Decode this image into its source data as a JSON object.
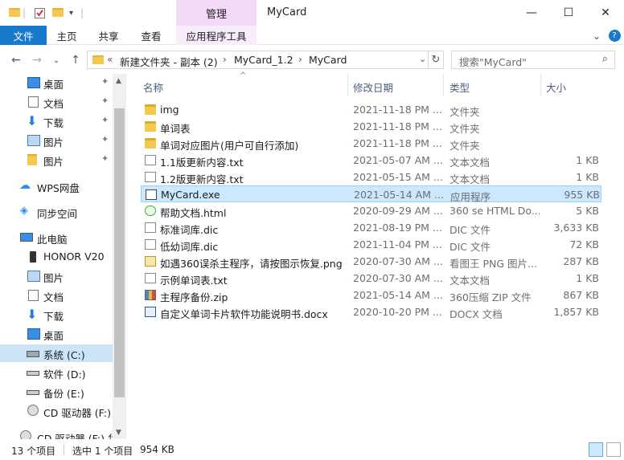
{
  "window": {
    "title": "MyCard",
    "context_tab": "管理",
    "controls": {
      "minimize": "—",
      "maximize": "☐",
      "close": "✕"
    }
  },
  "ribbon": {
    "tabs": [
      "文件",
      "主页",
      "共享",
      "查看",
      "应用程序工具"
    ],
    "expand": "⌄",
    "help": "?"
  },
  "address": {
    "overflow": "«",
    "crumbs": [
      "新建文件夹 - 副本 (2)",
      "MyCard_1.2",
      "MyCard"
    ],
    "dropdown": "⌄",
    "refresh": "↻"
  },
  "search": {
    "placeholder": "搜索\"MyCard\"",
    "icon": "search-icon"
  },
  "nav": {
    "back": "←",
    "forward": "→",
    "recent": "⌄",
    "up": "↑"
  },
  "sidebar": {
    "items": [
      {
        "label": "桌面",
        "icon": "desktop-icon",
        "pinned": true
      },
      {
        "label": "文档",
        "icon": "documents-icon",
        "pinned": true
      },
      {
        "label": "下载",
        "icon": "download-icon",
        "pinned": true
      },
      {
        "label": "图片",
        "icon": "pictures-icon",
        "pinned": true
      },
      {
        "label": "图片",
        "icon": "folder-icon",
        "pinned": true
      },
      {
        "label": "WPS网盘",
        "icon": "cloud-icon"
      },
      {
        "label": "同步空间",
        "icon": "sync-icon"
      },
      {
        "label": "此电脑",
        "icon": "computer-icon"
      },
      {
        "label": "HONOR V20",
        "icon": "phone-icon"
      },
      {
        "label": "图片",
        "icon": "pictures-icon"
      },
      {
        "label": "文档",
        "icon": "documents-icon"
      },
      {
        "label": "下载",
        "icon": "download-icon"
      },
      {
        "label": "桌面",
        "icon": "desktop-icon"
      },
      {
        "label": "系统 (C:)",
        "icon": "drive-icon",
        "selected": true
      },
      {
        "label": "软件 (D:)",
        "icon": "drive-icon"
      },
      {
        "label": "备份 (E:)",
        "icon": "drive-icon"
      },
      {
        "label": "CD 驱动器 (F:) 华",
        "icon": "cd-icon"
      },
      {
        "label": "CD 驱动器 (F:) 华",
        "icon": "cd-icon"
      }
    ],
    "pin": "📌"
  },
  "columns": {
    "name": "名称",
    "date": "修改日期",
    "type": "类型",
    "size": "大小"
  },
  "files": [
    {
      "name": "img",
      "date": "2021-11-18 PM ...",
      "type": "文件夹",
      "size": "",
      "icon": "folder-icon"
    },
    {
      "name": "单词表",
      "date": "2021-11-18 PM ...",
      "type": "文件夹",
      "size": "",
      "icon": "folder-icon"
    },
    {
      "name": "单词对应图片(用户可自行添加)",
      "date": "2021-11-18 PM ...",
      "type": "文件夹",
      "size": "",
      "icon": "folder-icon"
    },
    {
      "name": "1.1版更新内容.txt",
      "date": "2021-05-07 AM ...",
      "type": "文本文档",
      "size": "1 KB",
      "icon": "text-file-icon"
    },
    {
      "name": "1.2版更新内容.txt",
      "date": "2021-05-15 AM ...",
      "type": "文本文档",
      "size": "1 KB",
      "icon": "text-file-icon"
    },
    {
      "name": "MyCard.exe",
      "date": "2021-05-14 AM ...",
      "type": "应用程序",
      "size": "955 KB",
      "icon": "exe-icon",
      "selected": true
    },
    {
      "name": "帮助文档.html",
      "date": "2020-09-29 AM ...",
      "type": "360 se HTML Do...",
      "size": "5 KB",
      "icon": "html-icon"
    },
    {
      "name": "标准词库.dic",
      "date": "2021-08-19 PM ...",
      "type": "DIC 文件",
      "size": "3,633 KB",
      "icon": "file-icon"
    },
    {
      "name": "低幼词库.dic",
      "date": "2021-11-04 PM ...",
      "type": "DIC 文件",
      "size": "72 KB",
      "icon": "file-icon"
    },
    {
      "name": "如遇360误杀主程序，请按图示恢复.png",
      "date": "2020-07-30 AM ...",
      "type": "看图王 PNG 图片...",
      "size": "287 KB",
      "icon": "png-icon"
    },
    {
      "name": "示例单词表.txt",
      "date": "2020-07-30 AM ...",
      "type": "文本文档",
      "size": "1 KB",
      "icon": "text-file-icon"
    },
    {
      "name": "主程序备份.zip",
      "date": "2021-05-14 AM ...",
      "type": "360压缩 ZIP 文件",
      "size": "867 KB",
      "icon": "zip-icon"
    },
    {
      "name": "自定义单词卡片软件功能说明书.docx",
      "date": "2020-10-20 PM ...",
      "type": "DOCX 文档",
      "size": "1,857 KB",
      "icon": "docx-icon"
    }
  ],
  "status": {
    "count": "13 个项目",
    "selection": "选中 1 个项目",
    "size": "954 KB"
  }
}
